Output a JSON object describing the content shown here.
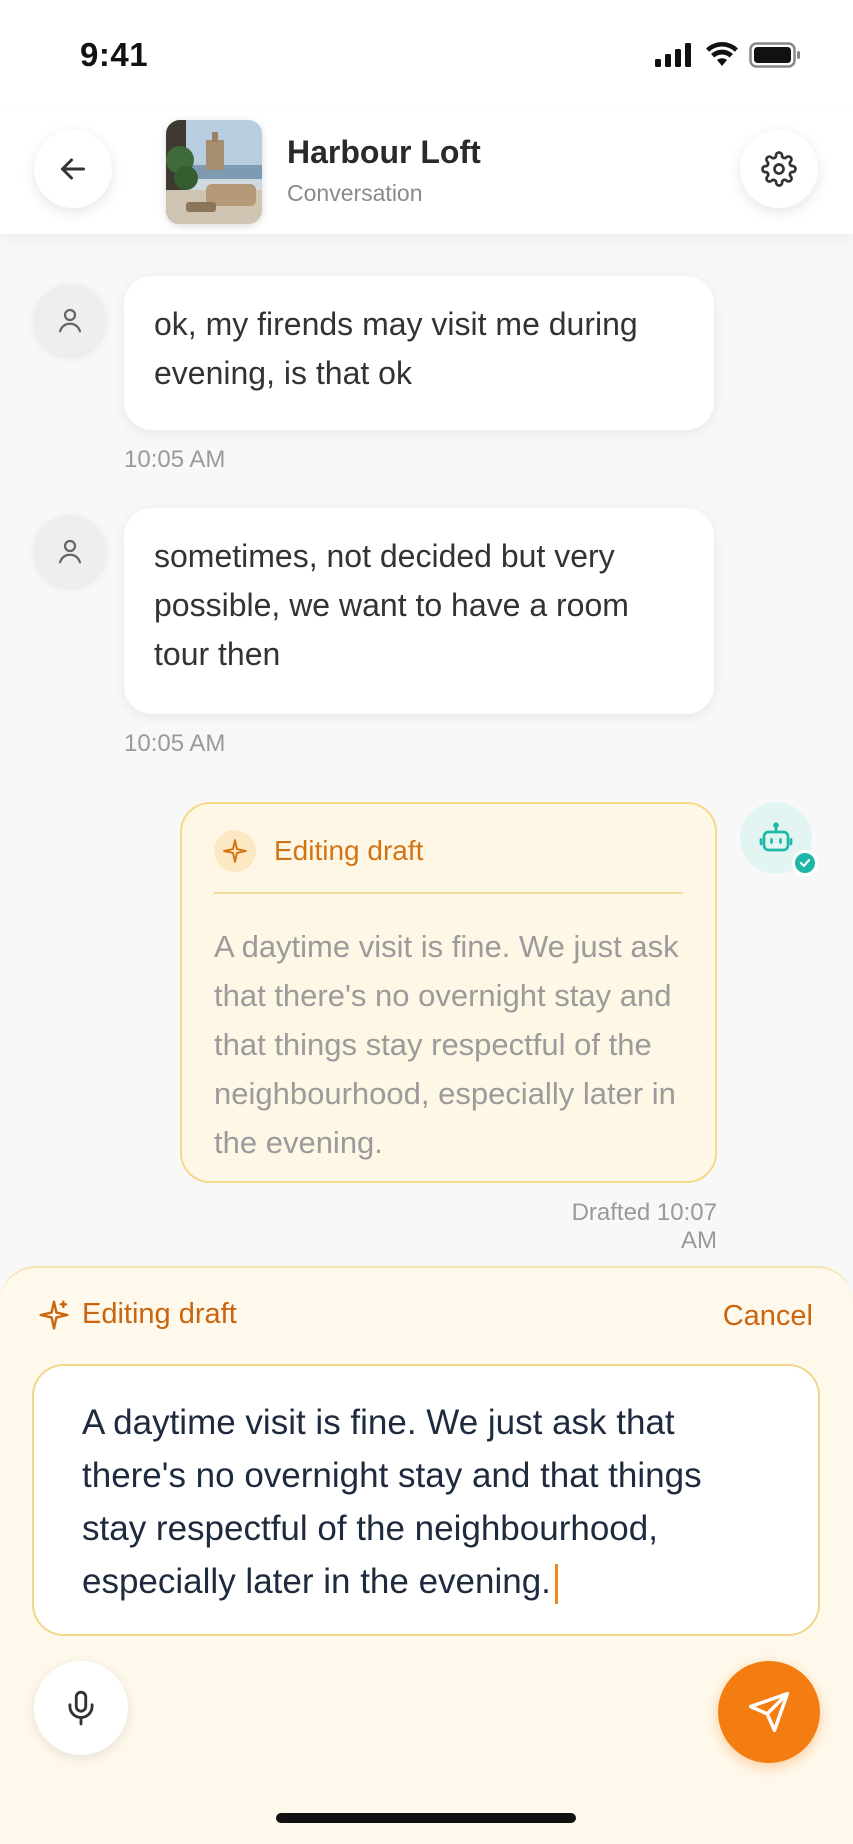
{
  "status_bar": {
    "time": "9:41"
  },
  "header": {
    "title": "Harbour Loft",
    "subtitle": "Conversation",
    "back_icon": "arrow-left-icon",
    "settings_icon": "gear-icon"
  },
  "messages": [
    {
      "text": "ok, my firends may visit me during evening, is that ok",
      "time": "10:05 AM"
    },
    {
      "text": "sometimes, not decided but very possible, we want to have a room tour then",
      "time": "10:05 AM"
    }
  ],
  "draft_card": {
    "label": "Editing draft",
    "body": "A daytime visit is fine. We just ask that there's no overnight stay and that things stay respectful of the neighbourhood, especially later in the evening.",
    "timestamp": "Drafted 10:07 AM"
  },
  "composer": {
    "label": "Editing draft",
    "cancel_label": "Cancel",
    "text": "A daytime visit is fine. We just ask that there's no overnight stay and that things stay respectful of the neighbourhood, especially later in the evening."
  },
  "colors": {
    "accent": "#f47d12",
    "draft_bg": "#fff7e6",
    "bot_teal": "#1fb8a8"
  }
}
